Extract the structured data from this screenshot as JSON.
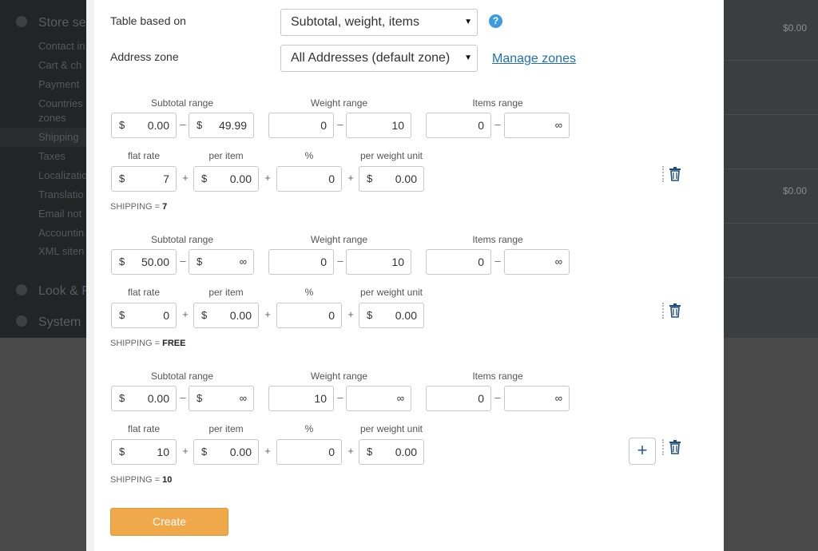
{
  "background": {
    "sidebar_groups": [
      "Store se",
      "Look & F",
      "System"
    ],
    "sidebar_items": [
      "Contact in",
      "Cart & ch",
      "Payment",
      "Countries",
      "zones",
      "Shipping",
      "Taxes",
      "Localizatio",
      "Translatio",
      "Email not",
      "Accountin",
      "XML siten"
    ],
    "prices": [
      "$0.00",
      "$0.00"
    ]
  },
  "form": {
    "table_based_on_label": "Table based on",
    "table_based_on_value": "Subtotal, weight, items",
    "address_zone_label": "Address zone",
    "address_zone_value": "All Addresses (default zone)",
    "manage_zones_link": "Manage zones",
    "help_glyph": "?"
  },
  "headers": {
    "subtotal_range": "Subtotal range",
    "weight_range": "Weight range",
    "items_range": "Items range",
    "flat_rate": "flat rate",
    "per_item": "per item",
    "percent": "%",
    "per_weight_unit": "per weight unit"
  },
  "symbols": {
    "currency": "$",
    "range_sep": "–",
    "plus": "+",
    "infinity": "∞",
    "shipping_prefix": "SHIPPING = "
  },
  "rows": [
    {
      "subtotal_from": "0.00",
      "subtotal_to": "49.99",
      "weight_from": "0",
      "weight_to": "10",
      "items_from": "0",
      "items_to": "∞",
      "flat_rate": "7",
      "per_item": "0.00",
      "percent": "0",
      "per_weight": "0.00",
      "shipping_result": "7"
    },
    {
      "subtotal_from": "50.00",
      "subtotal_to": "∞",
      "weight_from": "0",
      "weight_to": "10",
      "items_from": "0",
      "items_to": "∞",
      "flat_rate": "0",
      "per_item": "0.00",
      "percent": "0",
      "per_weight": "0.00",
      "shipping_result": "FREE"
    },
    {
      "subtotal_from": "0.00",
      "subtotal_to": "∞",
      "weight_from": "10",
      "weight_to": "∞",
      "items_from": "0",
      "items_to": "∞",
      "flat_rate": "10",
      "per_item": "0.00",
      "percent": "0",
      "per_weight": "0.00",
      "shipping_result": "10"
    }
  ],
  "actions": {
    "add_glyph": "+",
    "create_label": "Create"
  },
  "colors": {
    "accent_button": "#f0a94a",
    "link": "#1f6fb5",
    "help": "#3a9be0",
    "icon_dark": "#1f5d9a"
  }
}
